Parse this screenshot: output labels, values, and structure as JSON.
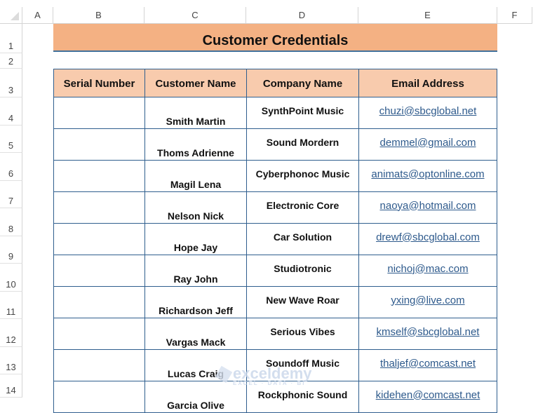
{
  "columns": [
    "A",
    "B",
    "C",
    "D",
    "E",
    "F"
  ],
  "rows": [
    "1",
    "2",
    "3",
    "4",
    "5",
    "6",
    "7",
    "8",
    "9",
    "10",
    "11",
    "12",
    "13",
    "14"
  ],
  "title": "Customer Credentials",
  "headers": [
    "Serial Number",
    "Customer Name",
    "Company Name",
    "Email Address"
  ],
  "records": [
    {
      "serial": "",
      "name": "Smith Martin",
      "company": "SynthPoint Music",
      "email": "chuzi@sbcglobal.net"
    },
    {
      "serial": "",
      "name": "Thoms Adrienne",
      "company": "Sound Mordern",
      "email": "demmel@gmail.com"
    },
    {
      "serial": "",
      "name": "Magil Lena",
      "company": "Cyberphonoc Music",
      "email": "animats@optonline.com"
    },
    {
      "serial": "",
      "name": "Nelson  Nick",
      "company": "Electronic Core",
      "email": "naoya@hotmail.com"
    },
    {
      "serial": "",
      "name": "Hope Jay",
      "company": "Car Solution",
      "email": "drewf@sbcglobal.com"
    },
    {
      "serial": "",
      "name": "Ray John",
      "company": "Studiotronic",
      "email": "nichoj@mac.com"
    },
    {
      "serial": "",
      "name": "Richardson Jeff",
      "company": "New Wave Roar",
      "email": "yxing@live.com"
    },
    {
      "serial": "",
      "name": "Vargas  Mack",
      "company": "Serious Vibes",
      "email": "kmself@sbcglobal.net"
    },
    {
      "serial": "",
      "name": "Lucas  Craig",
      "company": "Soundoff Music",
      "email": "thaljef@comcast.net"
    },
    {
      "serial": "",
      "name": "Garcia Olive",
      "company": "Rockphonic Sound",
      "email": "kidehen@comcast.net"
    }
  ],
  "watermark": {
    "brand": "exceldemy",
    "tagline": "EXCEL · DATA · BI"
  },
  "colors": {
    "title_fill": "#f4b183",
    "header_fill": "#f8cbad",
    "border": "#2f5e8e",
    "link": "#2e5a8c"
  }
}
